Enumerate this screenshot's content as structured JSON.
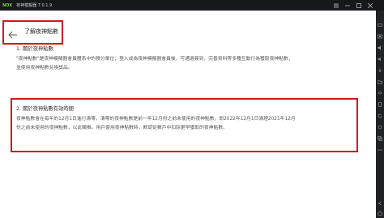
{
  "app": {
    "logo": "NOX",
    "title": "夜神模擬器 7.0.1.9"
  },
  "header": {
    "title": "了解夜神點數"
  },
  "sections": [
    {
      "title": "1. 關於夜神點數",
      "lines": [
        "\"夜神點數\"是夜神模擬器會員體系中的積分單位；登入成為夜神模擬器會員後，可通過簽到，完善資料等多種互動行為獲取夜神點數，",
        "並使用夜神點數兌換獎品。"
      ]
    },
    {
      "title": "2. 關於夜神點數有效時間",
      "lines": [
        "夜神點數會在每年的12月1日進行清零，清零的夜神點數是前一年12月份之前未使用的夜神點數，即2022年12月1日清理2021年12月",
        "份之前未使用的夜神點數，以此類推。用戶使用夜神點數時，默認從帳戶中扣除更早獲取的夜神點數。"
      ]
    }
  ]
}
